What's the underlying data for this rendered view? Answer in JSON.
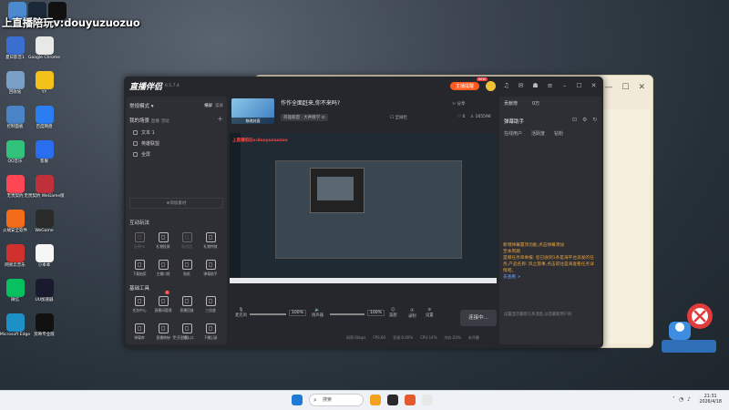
{
  "overlay_text": "上直播陪玩v:douyuzuozuo",
  "desktop_icons": [
    {
      "label": "",
      "color": "#4c8ad0"
    },
    {
      "label": "",
      "color": "#1b2838"
    },
    {
      "label": "",
      "color": "#111",
      "sub": "G HUB"
    },
    {
      "label": "夏日影音1",
      "color": "#3a6fd0"
    },
    {
      "label": "Google Chrome",
      "color": "#e8e8e8"
    },
    {
      "label": "回收站",
      "color": "#7aa0c8"
    },
    {
      "label": "YY",
      "color": "#f4c11a"
    },
    {
      "label": "控制面板",
      "color": "#4a83c6"
    },
    {
      "label": "百度网盘",
      "color": "#2b7ef2"
    },
    {
      "label": "QQ音乐",
      "color": "#31c27c"
    },
    {
      "label": "客服",
      "color": "#2a6ef0"
    },
    {
      "label": "无畏契约",
      "color": "#ff4655"
    },
    {
      "label": "无畏契约 WeGame版",
      "color": "#c0303a"
    },
    {
      "label": "火绒安全软件",
      "color": "#f26c1a"
    },
    {
      "label": "WeGame",
      "color": "#2a2a2a"
    },
    {
      "label": "网易云音乐",
      "color": "#d1312c"
    },
    {
      "label": "小本本",
      "color": "#f6f6f6"
    },
    {
      "label": "微信",
      "color": "#07c160"
    },
    {
      "label": "UU加速器",
      "color": "#1a1a2e"
    },
    {
      "label": "Microsoft Edge",
      "color": "#1e90c8"
    },
    {
      "label": "剪映专业版",
      "color": "#111"
    }
  ],
  "app": {
    "logo": "直播伴侣",
    "version": "6.5.7.4",
    "hint_label": "主播提醒",
    "hint_badge": "NEW",
    "scene_mode": "常规模式",
    "mode_tabs": [
      "横屏",
      "竖屏"
    ],
    "my_scenes": "我的场景",
    "scene_tabs": [
      "直播",
      "活动"
    ],
    "sources": [
      "文本 1",
      "英雄联盟",
      "全屏"
    ],
    "add_source": "添加素材",
    "interact_title": "互动玩法",
    "interact_tools": [
      {
        "label": "连线PK",
        "dim": true
      },
      {
        "label": "礼物投屏",
        "dim": false
      },
      {
        "label": "粉丝团",
        "dim": true
      },
      {
        "label": "礼物特效",
        "dim": false
      },
      {
        "label": "下载抽奖",
        "dim": false
      },
      {
        "label": "主播口袋",
        "dim": false
      },
      {
        "label": "贴纸",
        "dim": false
      },
      {
        "label": "弹幕助手",
        "dim": false
      }
    ],
    "basic_title": "基础工具",
    "basic_tools": [
      {
        "label": "任务中心",
        "badge": ""
      },
      {
        "label": "直播间管理",
        "badge": "1"
      },
      {
        "label": "直播回放",
        "badge": ""
      },
      {
        "label": "三倍速",
        "badge": ""
      },
      {
        "label": "弹幕库",
        "badge": ""
      },
      {
        "label": "直播地址",
        "badge": ""
      },
      {
        "label": "主播入口",
        "badge": ""
      },
      {
        "label": "下播记录",
        "badge": ""
      }
    ],
    "more_features": "更多功能",
    "room_title": "作作全面赶来,你不来吗?",
    "thumb_caption": "修改封面",
    "room_category": "英雄联盟 · 大神教学",
    "share_label": "分享",
    "online_label": "全局拦",
    "likes": "0",
    "followers": "165596",
    "mic_label": "麦克风",
    "mic_pct": "100%",
    "speaker_label": "扬声器",
    "speaker_pct": "100%",
    "beauty_label": "美颜",
    "record_label": "录制",
    "settings_label": "设置",
    "go_live": "连接中...",
    "stats": [
      "码率:0kbps",
      "FPS:60",
      "丢帧:0.00%",
      "CPU:14%",
      "内存:24%",
      "未开播"
    ]
  },
  "right_panel": {
    "contribution": "贡献榜",
    "rank": "0万",
    "danmu_title": "弹幕助手",
    "tabs": [
      "在线用户",
      "活跃度",
      "钻粉"
    ],
    "messages": [
      {
        "text": "新增弹幕置顶功能,点击弹幕添加",
        "style": "warn"
      },
      {
        "text": "至本周期",
        "style": "warn"
      },
      {
        "text": "是哪任务单举报: 您已收到1条是海平台派发的任务,产品名称: 风之旅事,点击前往是海查看任务详情吧。",
        "style": "warn"
      },
      {
        "text": "去查看 >",
        "style": "blue"
      }
    ],
    "hint": "设置显示最新几条消息,以及最新用户的"
  },
  "taskbar": {
    "search": "搜索",
    "time": "21:31",
    "date": "2026/4/18"
  }
}
